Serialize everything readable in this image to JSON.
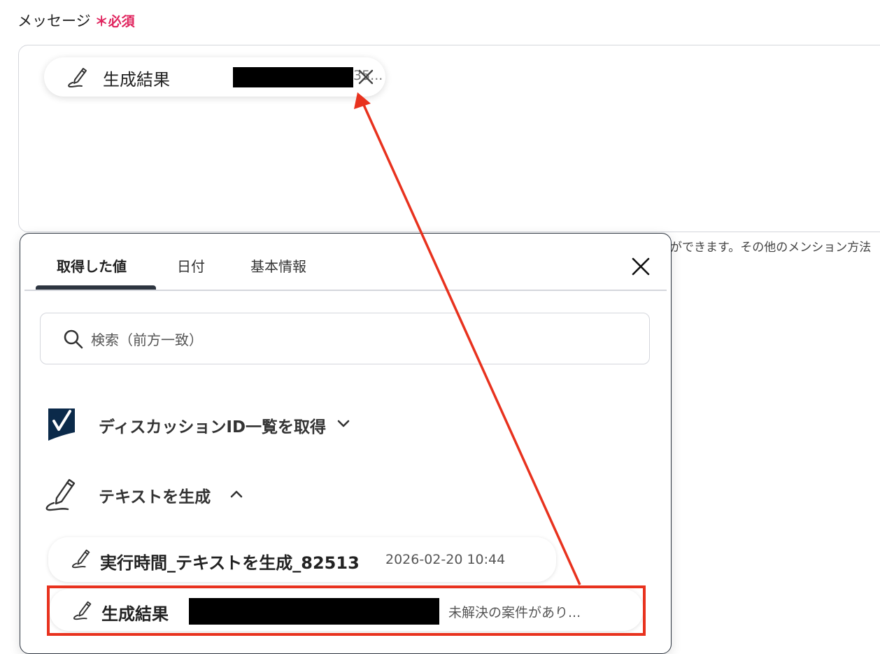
{
  "field": {
    "label": "メッセージ",
    "required_mark": "＊",
    "required_text": "必須"
  },
  "chip": {
    "label": "生成結果",
    "trailing": "35...",
    "icon": "pen-scribble-icon",
    "close_icon": "close-icon"
  },
  "helper_text": "ができます。その他のメンション方法",
  "panel": {
    "tabs": [
      {
        "label": "取得した値",
        "active": true
      },
      {
        "label": "日付",
        "active": false
      },
      {
        "label": "基本情報",
        "active": false
      }
    ],
    "search_placeholder": "検索（前方一致）",
    "groups": [
      {
        "label": "ディスカッションID一覧を取得",
        "icon": "smartsheet-logo-icon",
        "expanded": false
      },
      {
        "label": "テキストを生成",
        "icon": "pen-scribble-icon",
        "expanded": true
      }
    ],
    "items": [
      {
        "label": "実行時間_テキストを生成_82513",
        "value": "2026-02-20 10:44"
      },
      {
        "label": "生成結果",
        "value": "未解決の案件があり..."
      }
    ]
  },
  "colors": {
    "accent_red": "#e8321e",
    "required_pink": "#e0245e",
    "dark": "#2d3540"
  }
}
